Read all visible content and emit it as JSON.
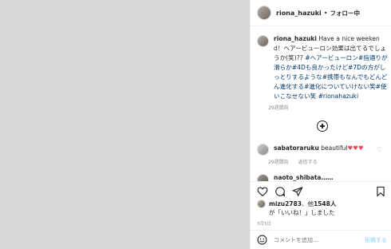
{
  "post": {
    "username": "riona_hazuki",
    "separator": "•",
    "follow_state": "フォロー中"
  },
  "caption": {
    "username": "riona_hazuki",
    "text": "Have a nice weekend！ヘアービューロン効果は出てるでしょうか(笑)??",
    "hashtags": "#ヘアービューロン#指通りが滑らか#4Dも良かったけど#7Dの方がしっとりするような#携帯もなんでもどんどん進化する#進化についていけない笑#使いこなせない笑 #rionahazuki",
    "time": "29週間前"
  },
  "comments": [
    {
      "username": "sabatoraruku",
      "text": "beautiful",
      "hearts": "♥♥♥",
      "time": "29週間前",
      "reply": "返信する"
    }
  ],
  "partial_comment": {
    "username": "naoto_shibata……"
  },
  "likes": {
    "liker": "mizu2783",
    "connector": "、他",
    "count_text": "1548人",
    "suffix": "が「いいね！」しました",
    "date": "3月5日"
  },
  "add_comment": {
    "placeholder": "コメントを追加...",
    "post_label": "投稿する"
  },
  "icons": {
    "like": "heart-icon",
    "comment": "comment-icon",
    "share": "share-icon",
    "save": "bookmark-icon",
    "load_more": "plus-circle-icon",
    "emoji": "smile-icon"
  },
  "colors": {
    "hashtag": "#00376b",
    "heart": "#ed4956",
    "muted": "#8e8e8e",
    "post_button_disabled": "#b2dffc"
  }
}
